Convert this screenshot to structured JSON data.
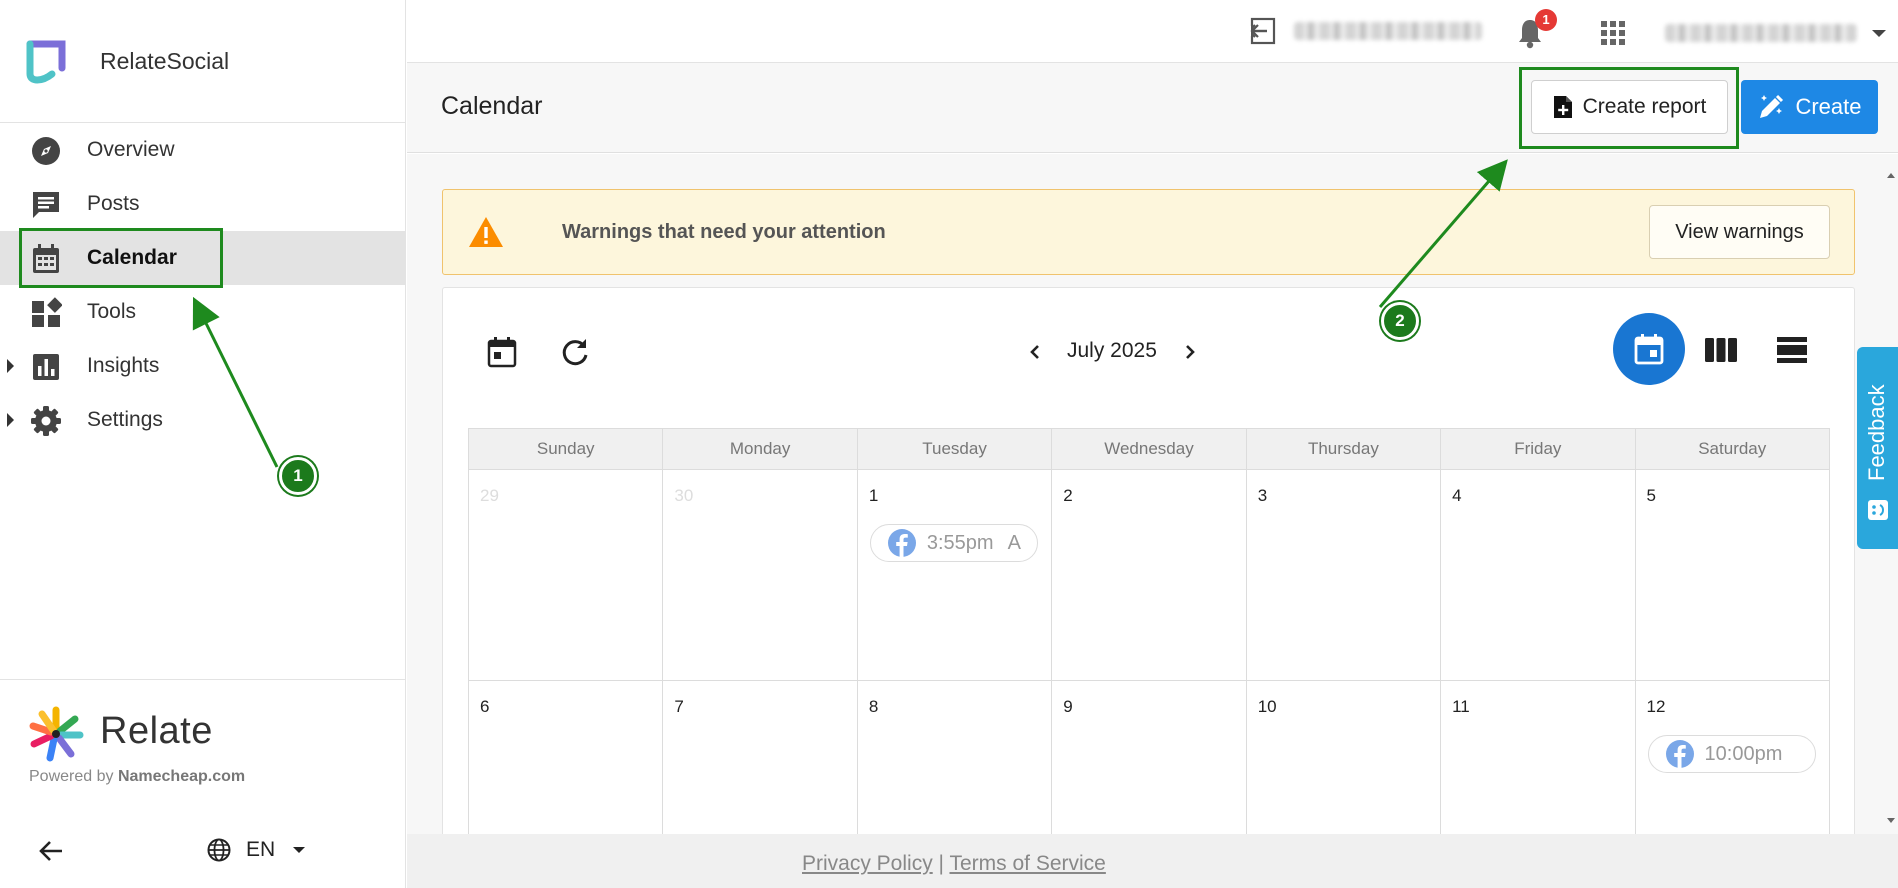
{
  "brand": {
    "name": "RelateSocial"
  },
  "nav": {
    "items": [
      {
        "label": "Overview",
        "icon": "compass-icon"
      },
      {
        "label": "Posts",
        "icon": "chat-icon"
      },
      {
        "label": "Calendar",
        "icon": "calendar-icon",
        "active": true
      },
      {
        "label": "Tools",
        "icon": "tools-icon"
      },
      {
        "label": "Insights",
        "icon": "bar-chart-icon",
        "expandable": true
      },
      {
        "label": "Settings",
        "icon": "gear-icon",
        "expandable": true
      }
    ]
  },
  "sidebar_footer": {
    "logo_name": "Relate",
    "powered_prefix": "Powered by ",
    "powered_brand": "Namecheap.com",
    "language": "EN"
  },
  "topbar": {
    "notification_count": "1"
  },
  "header": {
    "title": "Calendar",
    "create_report_label": "Create report",
    "create_label": "Create"
  },
  "warning": {
    "text": "Warnings that need your attention",
    "button_label": "View warnings"
  },
  "calendar": {
    "month_label": "July 2025",
    "weekdays": [
      "Sunday",
      "Monday",
      "Tuesday",
      "Wednesday",
      "Thursday",
      "Friday",
      "Saturday"
    ],
    "weeks": [
      [
        "29",
        "30",
        "1",
        "2",
        "3",
        "4",
        "5"
      ],
      [
        "6",
        "7",
        "8",
        "9",
        "10",
        "11",
        "12"
      ]
    ],
    "events": [
      {
        "day": "1",
        "time": "3:55pm",
        "tag": "A",
        "network": "facebook-icon"
      },
      {
        "day": "12",
        "time": "10:00pm",
        "tag": "",
        "network": "facebook-icon"
      }
    ]
  },
  "feedback": {
    "label": "Feedback"
  },
  "footer": {
    "privacy_label": "Privacy Policy",
    "separator": "|",
    "terms_label": "Terms of Service"
  },
  "annotations": [
    "1",
    "2"
  ],
  "colors": {
    "primary": "#1e88e5",
    "active_view": "#1976d2",
    "warning_bg": "#fdf6dc",
    "annotation_green": "#1e8a1e",
    "feedback": "#2aa7dc",
    "badge": "#e53935"
  }
}
